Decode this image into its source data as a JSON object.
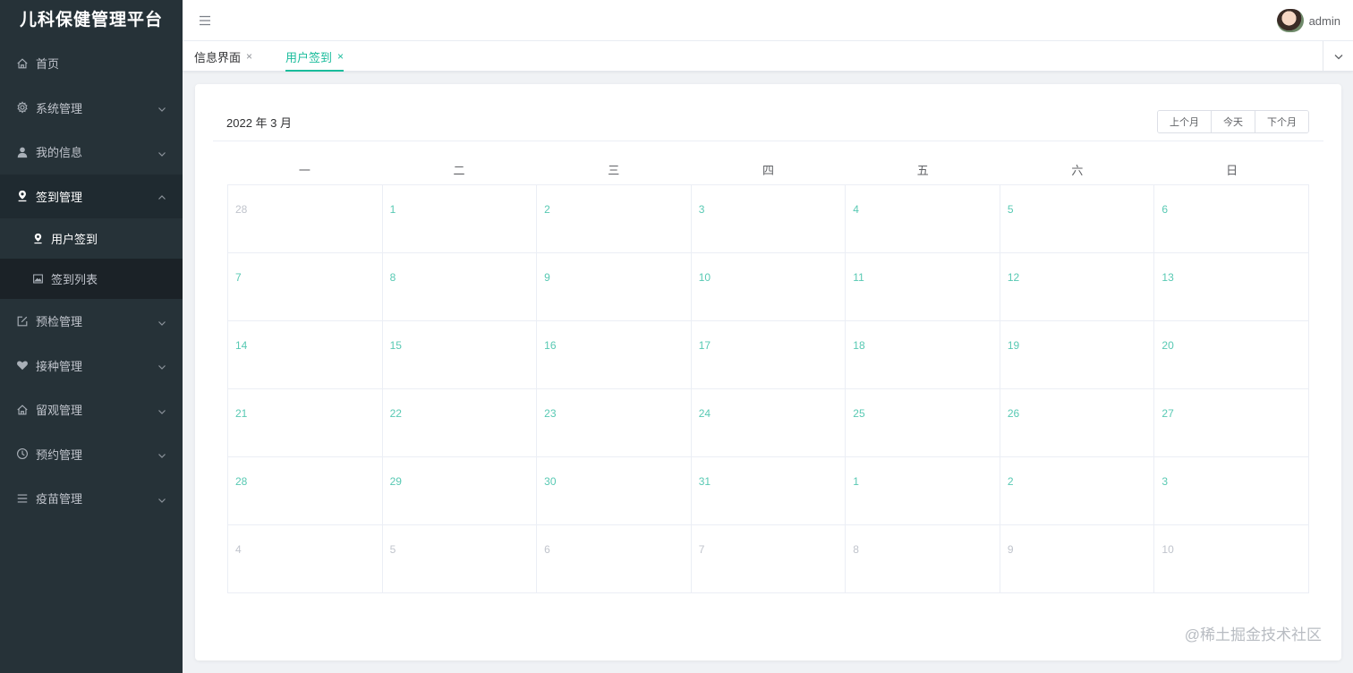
{
  "app": {
    "title": "儿科保健管理平台"
  },
  "sidebar": {
    "items": [
      {
        "label": "首页",
        "icon": "home-icon",
        "expandable": false
      },
      {
        "label": "系统管理",
        "icon": "gear-icon",
        "expandable": true
      },
      {
        "label": "我的信息",
        "icon": "user-icon",
        "expandable": true
      },
      {
        "label": "签到管理",
        "icon": "location-pin-icon",
        "expandable": true,
        "open": true
      },
      {
        "label": "预检管理",
        "icon": "edit-icon",
        "expandable": true
      },
      {
        "label": "接种管理",
        "icon": "heart-icon",
        "expandable": true
      },
      {
        "label": "留观管理",
        "icon": "home-icon",
        "expandable": true
      },
      {
        "label": "预约管理",
        "icon": "clock-icon",
        "expandable": true
      },
      {
        "label": "疫苗管理",
        "icon": "list-icon",
        "expandable": true
      }
    ],
    "submenu": [
      {
        "label": "用户签到",
        "icon": "location-pin-icon",
        "active": true
      },
      {
        "label": "签到列表",
        "icon": "picture-icon",
        "active": false
      }
    ]
  },
  "header": {
    "user": "admin"
  },
  "tabs": [
    {
      "label": "信息界面",
      "close": "×"
    },
    {
      "label": "用户签到",
      "close": "×"
    }
  ],
  "calendar": {
    "title": "2022 年 3 月",
    "buttons": {
      "prev": "上个月",
      "today": "今天",
      "next": "下个月"
    },
    "weekdays": [
      "一",
      "二",
      "三",
      "四",
      "五",
      "六",
      "日"
    ],
    "weeks": [
      [
        "28",
        "1",
        "2",
        "3",
        "4",
        "5",
        "6"
      ],
      [
        "7",
        "8",
        "9",
        "10",
        "11",
        "12",
        "13"
      ],
      [
        "14",
        "15",
        "16",
        "17",
        "18",
        "19",
        "20"
      ],
      [
        "21",
        "22",
        "23",
        "24",
        "25",
        "26",
        "27"
      ],
      [
        "28",
        "29",
        "30",
        "31",
        "1",
        "2",
        "3"
      ],
      [
        "4",
        "5",
        "6",
        "7",
        "8",
        "9",
        "10"
      ]
    ],
    "accent_color": "#58c9b3",
    "other_month_color": "#c0c4cc"
  },
  "watermark": "@稀土掘金技术社区"
}
